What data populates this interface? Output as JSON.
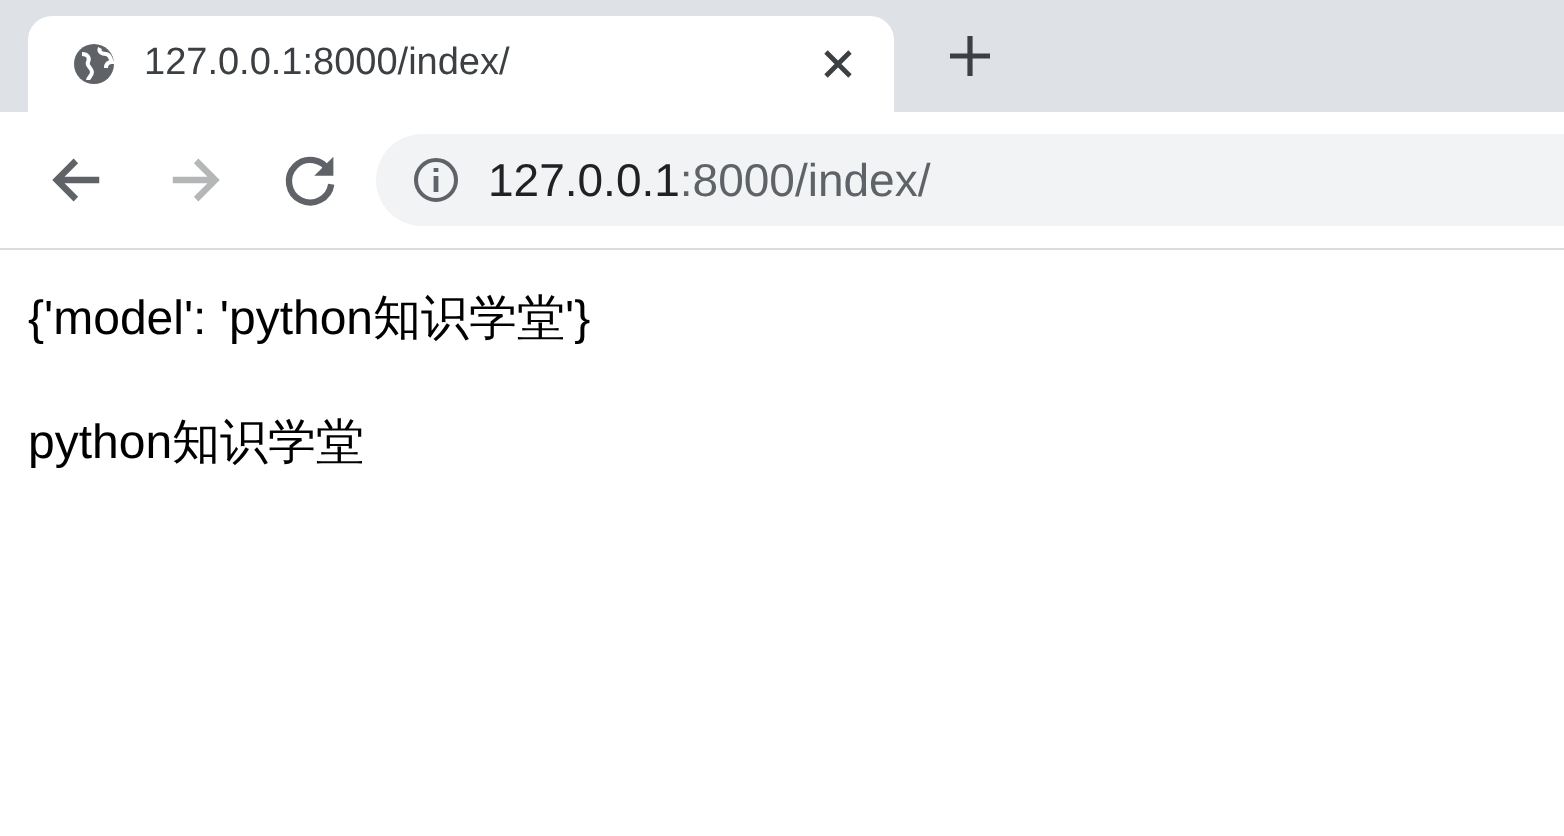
{
  "tabs": [
    {
      "title": "127.0.0.1:8000/index/",
      "selected": true
    }
  ],
  "toolbar": {
    "back": {
      "disabled": false
    },
    "forward": {
      "disabled": true
    }
  },
  "address_bar": {
    "host": "127.0.0.1",
    "path": ":8000/index/"
  },
  "content": {
    "paragraphs": [
      "{'model': 'python知识学堂'}",
      "python知识学堂"
    ]
  }
}
